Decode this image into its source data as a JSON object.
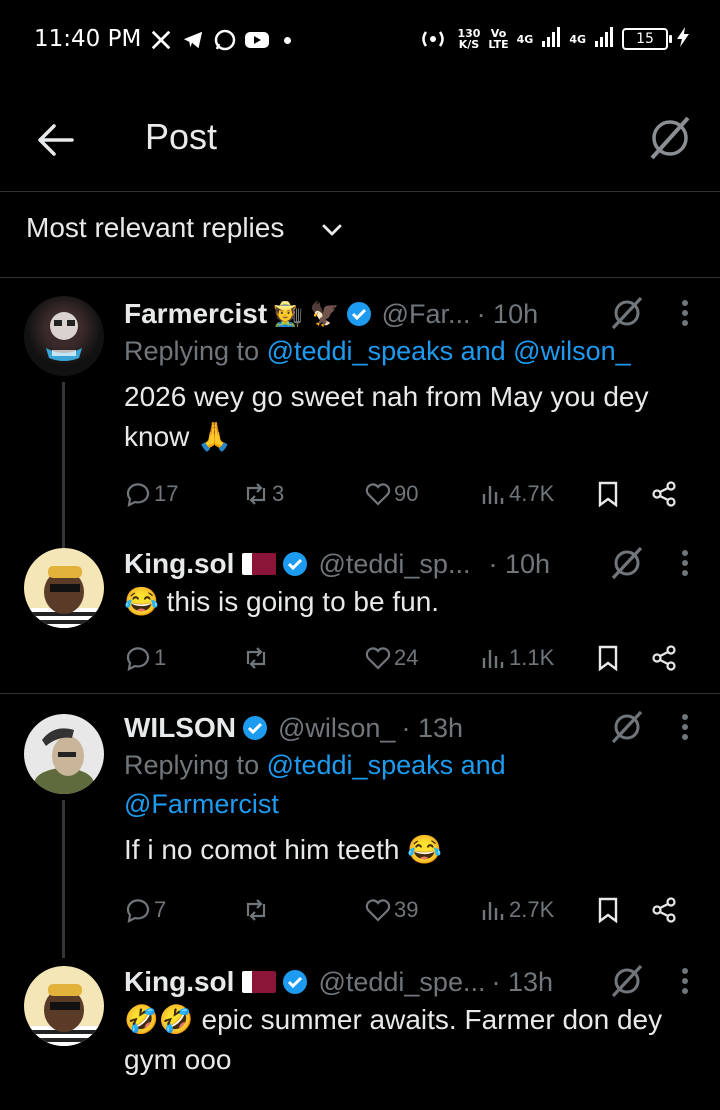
{
  "status_bar": {
    "time": "11:40 PM",
    "net_speed_value": "130",
    "net_speed_unit": "K/S",
    "volte_top": "Vo",
    "volte_bottom": "LTE",
    "net1": "4G",
    "net2": "4G",
    "battery": "15"
  },
  "header": {
    "title": "Post"
  },
  "sort": {
    "label": "Most relevant replies"
  },
  "posts": [
    {
      "name": "Farmercist",
      "emojis": "🧑‍🌾 🦅",
      "handle": "@Far...",
      "time": "· 10h",
      "replying_prefix": "Replying to ",
      "replying_targets": "@teddi_speaks and @wilson_",
      "text": "2026 wey go sweet nah from May you dey know 🙏",
      "replies": "17",
      "reposts": "3",
      "likes": "90",
      "views": "4.7K"
    },
    {
      "name": "King.sol",
      "handle": "@teddi_sp...",
      "time": "· 10h",
      "text": "😂 this is going to be fun.",
      "replies": "1",
      "reposts": "",
      "likes": "24",
      "views": "1.1K"
    },
    {
      "name": "WILSON",
      "handle": "@wilson_",
      "time": "· 13h",
      "replying_prefix": "Replying to ",
      "replying_targets_line1": "@teddi_speaks and",
      "replying_targets_line2": "@Farmercist",
      "text": "If i no comot him teeth 😂",
      "replies": "7",
      "reposts": "",
      "likes": "39",
      "views": "2.7K"
    },
    {
      "name": "King.sol",
      "handle": "@teddi_spe...",
      "time": "· 13h",
      "text": "🤣🤣 epic summer awaits. Farmer don dey gym ooo"
    }
  ],
  "colors": {
    "background": "#000000",
    "text": "#e7e9ea",
    "muted": "#71767b",
    "link": "#1d9bf0",
    "verified": "#1d9bf0",
    "divider": "#2f3336"
  },
  "icons": [
    "back-arrow-icon",
    "grok-icon",
    "chevron-down-icon",
    "verified-icon",
    "more-icon",
    "reply-icon",
    "repost-icon",
    "like-icon",
    "views-icon",
    "bookmark-icon",
    "share-icon"
  ]
}
